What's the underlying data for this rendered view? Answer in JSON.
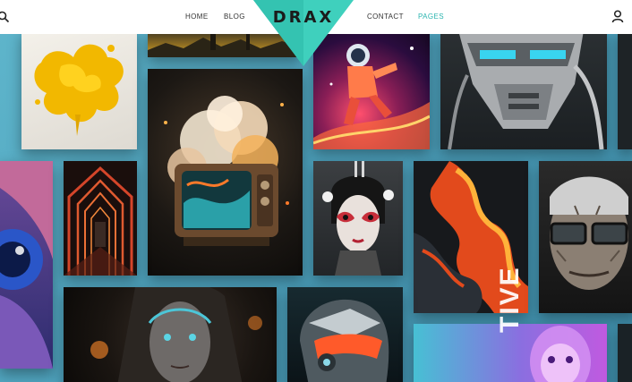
{
  "nav": {
    "links": [
      {
        "label": "HOME"
      },
      {
        "label": "BLOG"
      },
      {
        "label": "CONTACT"
      },
      {
        "label": "PAGES"
      }
    ],
    "logo": "DRAX",
    "accent": "#2cb5b0",
    "search_icon": "search-icon",
    "user_icon": "user-icon"
  },
  "gallery": {
    "background": "#56a9c1",
    "artworks": [
      {
        "subject": "yellow-paint-splash"
      },
      {
        "subject": "landscape-top"
      },
      {
        "subject": "astronaut-space-art"
      },
      {
        "subject": "robot-head"
      },
      {
        "subject": "exploding-tv"
      },
      {
        "subject": "blue-eye-closeup"
      },
      {
        "subject": "red-arch-tunnel"
      },
      {
        "subject": "geisha-portrait"
      },
      {
        "subject": "lava-swirl"
      },
      {
        "subject": "old-man-glasses"
      },
      {
        "subject": "dark-goddess-portrait"
      },
      {
        "subject": "helmet-portrait"
      },
      {
        "subject": "creative-neon-face"
      }
    ],
    "creative_text": "TIVE"
  }
}
